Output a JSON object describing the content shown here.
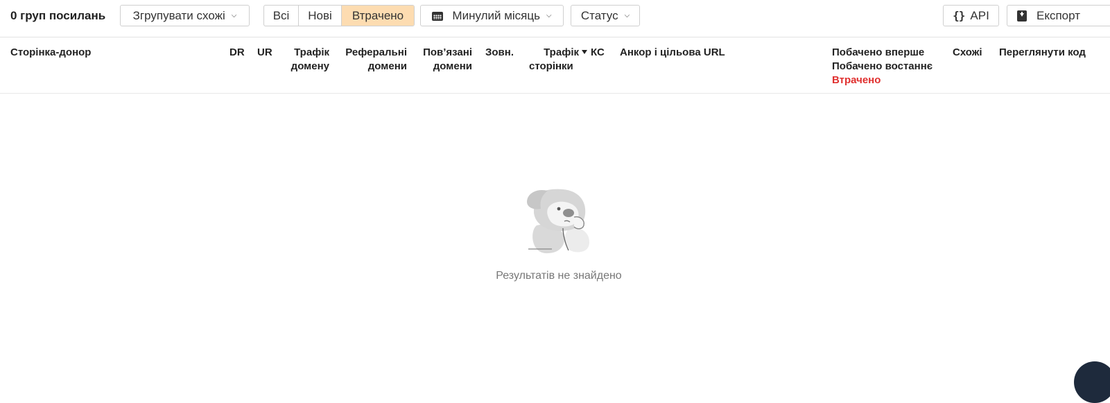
{
  "toolbar": {
    "count_label": "0 груп посилань",
    "group_similar": "Згрупувати схожі",
    "filter_tabs": [
      {
        "label": "Всі",
        "active": false
      },
      {
        "label": "Нові",
        "active": false
      },
      {
        "label": "Втрачено",
        "active": true
      }
    ],
    "period": "Минулий місяць",
    "status": "Статус",
    "api": "API",
    "export": "Експорт"
  },
  "columns": {
    "donor_page": "Сторінка-донор",
    "dr": "DR",
    "ur": "UR",
    "domain_traffic_1": "Трафік",
    "domain_traffic_2": "домену",
    "referring_1": "Реферальні",
    "referring_2": "домени",
    "linked_1": "Пов’язані",
    "linked_2": "домени",
    "external": "Зовн.",
    "page_traffic_1": "Трафік",
    "page_traffic_2": "сторінки",
    "kc": "КС",
    "anchor": "Анкор і цільова URL",
    "first_seen": "Побачено вперше",
    "last_seen": "Побачено востаннє",
    "lost": "Втрачено",
    "similar": "Схожі",
    "view_code": "Переглянути код"
  },
  "empty_state": {
    "message": "Результатів не знайдено"
  },
  "colors": {
    "active_tab": "#fddcb1",
    "lost_red": "#e0302f"
  }
}
